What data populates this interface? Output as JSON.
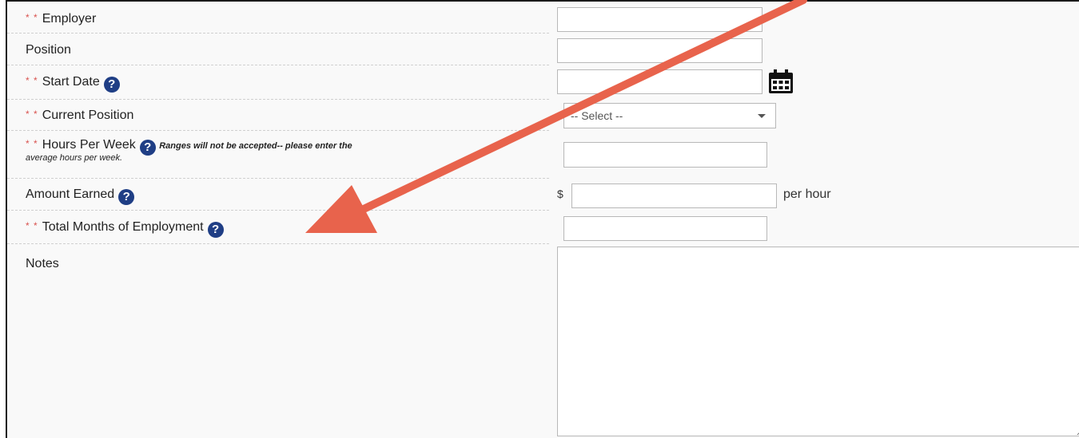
{
  "form": {
    "required_marker": "* *",
    "employer_label": "Employer",
    "position_label": "Position",
    "start_date_label": "Start Date",
    "current_position_label": "Current Position",
    "hours_per_week_label": "Hours Per Week",
    "hours_note_line1": "Ranges will not be accepted-- please enter the",
    "hours_note_line2": "average hours per week.",
    "amount_earned_label": "Amount Earned",
    "currency_symbol": "$",
    "per_hour_label": "per hour",
    "total_months_label": "Total Months of Employment",
    "notes_label": "Notes",
    "current_position_select": "-- Select --",
    "help_glyph": "?"
  },
  "icons": {
    "calendar": "calendar-icon",
    "help": "question-circle-icon",
    "dropdown": "chevron-down-icon"
  },
  "colors": {
    "required": "#d9534f",
    "help_icon": "#1f3e85",
    "annotation_arrow": "#e8634c"
  }
}
